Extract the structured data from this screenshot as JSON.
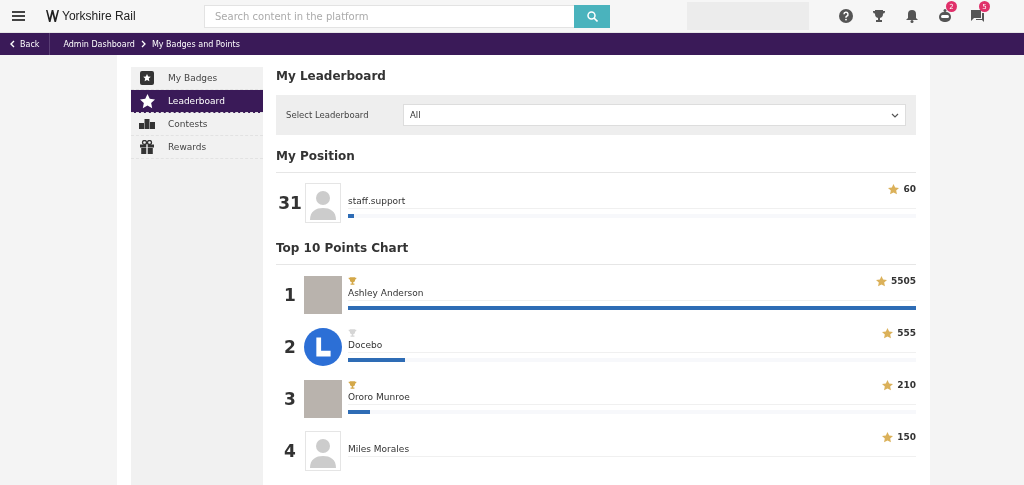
{
  "header": {
    "brand": "Yorkshire Rail",
    "search": {
      "placeholder": "Search content in the platform"
    },
    "icons": [
      {
        "kind": "help"
      },
      {
        "kind": "trophy"
      },
      {
        "kind": "bell"
      },
      {
        "kind": "robot",
        "badge": "2"
      },
      {
        "kind": "chat",
        "badge": "5"
      }
    ]
  },
  "breadcrumb": {
    "back": "Back",
    "items": [
      "Admin Dashboard",
      "My Badges and Points"
    ]
  },
  "sidebar": {
    "items": [
      {
        "label": "My Badges",
        "kind": "badge",
        "selected": false
      },
      {
        "label": "Leaderboard",
        "kind": "star",
        "selected": true
      },
      {
        "label": "Contests",
        "kind": "podium",
        "selected": false
      },
      {
        "label": "Rewards",
        "kind": "gift",
        "selected": false
      }
    ]
  },
  "main": {
    "title": "My Leaderboard",
    "select": {
      "label": "Select Leaderboard",
      "value": "All"
    },
    "position_title": "My Position",
    "position": {
      "rank": "31",
      "name": "staff.support",
      "points": "60",
      "level": 0.011,
      "kind": "silhouette"
    },
    "chart_title": "Top 10 Points Chart",
    "rows": [
      {
        "rank": "1",
        "name": "Ashley Anderson",
        "points": "5505",
        "level": 1.0,
        "kind": "photo",
        "color": "#d4a849"
      },
      {
        "rank": "2",
        "name": "Docebo",
        "points": "555",
        "level": 0.1,
        "kind": "logo",
        "color": "#d6d6d6"
      },
      {
        "rank": "3",
        "name": "Ororo Munroe",
        "points": "210",
        "level": 0.038,
        "kind": "photo",
        "color": "#d4a849"
      },
      {
        "rank": "4",
        "name": "Miles Morales",
        "points": "150",
        "kind": "silhouette"
      }
    ]
  }
}
